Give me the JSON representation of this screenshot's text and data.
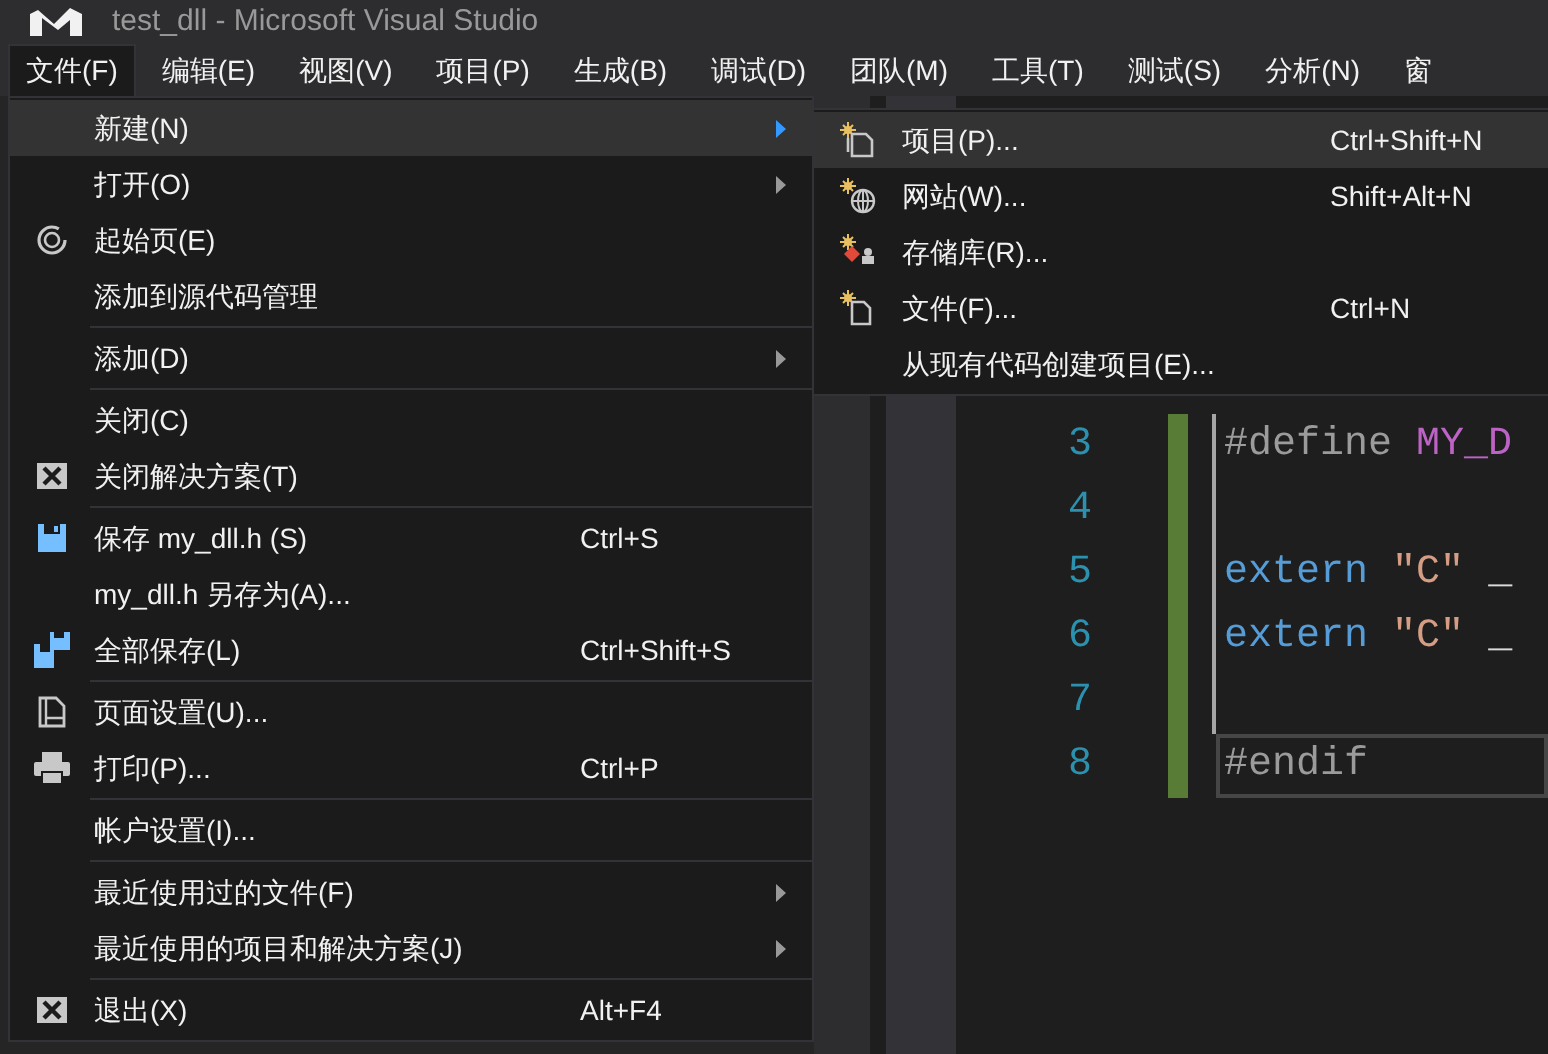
{
  "window": {
    "title": "test_dll - Microsoft Visual Studio"
  },
  "menu_bar": [
    {
      "label": "文件(F)",
      "selected": true
    },
    {
      "label": "编辑(E)",
      "selected": false
    },
    {
      "label": "视图(V)",
      "selected": false
    },
    {
      "label": "项目(P)",
      "selected": false
    },
    {
      "label": "生成(B)",
      "selected": false
    },
    {
      "label": "调试(D)",
      "selected": false
    },
    {
      "label": "团队(M)",
      "selected": false
    },
    {
      "label": "工具(T)",
      "selected": false
    },
    {
      "label": "测试(S)",
      "selected": false
    },
    {
      "label": "分析(N)",
      "selected": false
    },
    {
      "label": "窗",
      "selected": false
    }
  ],
  "file_menu": {
    "groups": [
      [
        {
          "label": "新建(N)",
          "submenu": true,
          "selected": true
        },
        {
          "label": "打开(O)",
          "submenu": true,
          "selected": false
        },
        {
          "label": "起始页(E)",
          "submenu": false,
          "selected": false
        },
        {
          "label": "添加到源代码管理",
          "submenu": false,
          "selected": false
        }
      ],
      [
        {
          "label": "添加(D)",
          "submenu": true,
          "selected": false
        }
      ],
      [
        {
          "label": "关闭(C)",
          "submenu": false,
          "selected": false
        },
        {
          "label": "关闭解决方案(T)",
          "submenu": false,
          "selected": false
        }
      ],
      [
        {
          "label": "保存 my_dll.h (S)",
          "shortcut": "Ctrl+S",
          "submenu": false,
          "selected": false
        },
        {
          "label": "my_dll.h 另存为(A)...",
          "submenu": false,
          "selected": false
        },
        {
          "label": "全部保存(L)",
          "shortcut": "Ctrl+Shift+S",
          "submenu": false,
          "selected": false
        }
      ],
      [
        {
          "label": "页面设置(U)...",
          "submenu": false,
          "selected": false
        },
        {
          "label": "打印(P)...",
          "shortcut": "Ctrl+P",
          "submenu": false,
          "selected": false
        }
      ],
      [
        {
          "label": "帐户设置(I)...",
          "submenu": false,
          "selected": false
        }
      ],
      [
        {
          "label": "最近使用过的文件(F)",
          "submenu": true,
          "selected": false
        },
        {
          "label": "最近使用的项目和解决方案(J)",
          "submenu": true,
          "selected": false
        }
      ],
      [
        {
          "label": "退出(X)",
          "shortcut": "Alt+F4",
          "submenu": false,
          "selected": false
        }
      ]
    ]
  },
  "new_submenu": {
    "items": [
      {
        "label": "项目(P)...",
        "shortcut": "Ctrl+Shift+N",
        "selected": true
      },
      {
        "label": "网站(W)...",
        "shortcut": "Shift+Alt+N",
        "selected": false
      },
      {
        "label": "存储库(R)...",
        "selected": false
      },
      {
        "label": "文件(F)...",
        "shortcut": "Ctrl+N",
        "selected": false
      },
      {
        "label": "从现有代码创建项目(E)...",
        "selected": false
      }
    ]
  },
  "editor": {
    "lines": [
      {
        "number": "3",
        "current": false,
        "tokens": [
          {
            "kind": "directive",
            "text": "#define"
          },
          {
            "kind": "macro",
            "text": "MY_D"
          }
        ]
      },
      {
        "number": "4",
        "current": false
      },
      {
        "number": "5",
        "current": false,
        "tokens": [
          {
            "kind": "keyword",
            "text": "extern"
          },
          {
            "kind": "string",
            "text": "″C″"
          },
          {
            "kind": "plain",
            "text": "_"
          }
        ]
      },
      {
        "number": "6",
        "current": false,
        "tokens": [
          {
            "kind": "keyword",
            "text": "extern"
          },
          {
            "kind": "string",
            "text": "″C″"
          },
          {
            "kind": "plain",
            "text": "_"
          }
        ]
      },
      {
        "number": "7",
        "current": false
      },
      {
        "number": "8",
        "current": true,
        "tokens": [
          {
            "kind": "directive",
            "text": "#endif"
          }
        ]
      }
    ]
  }
}
